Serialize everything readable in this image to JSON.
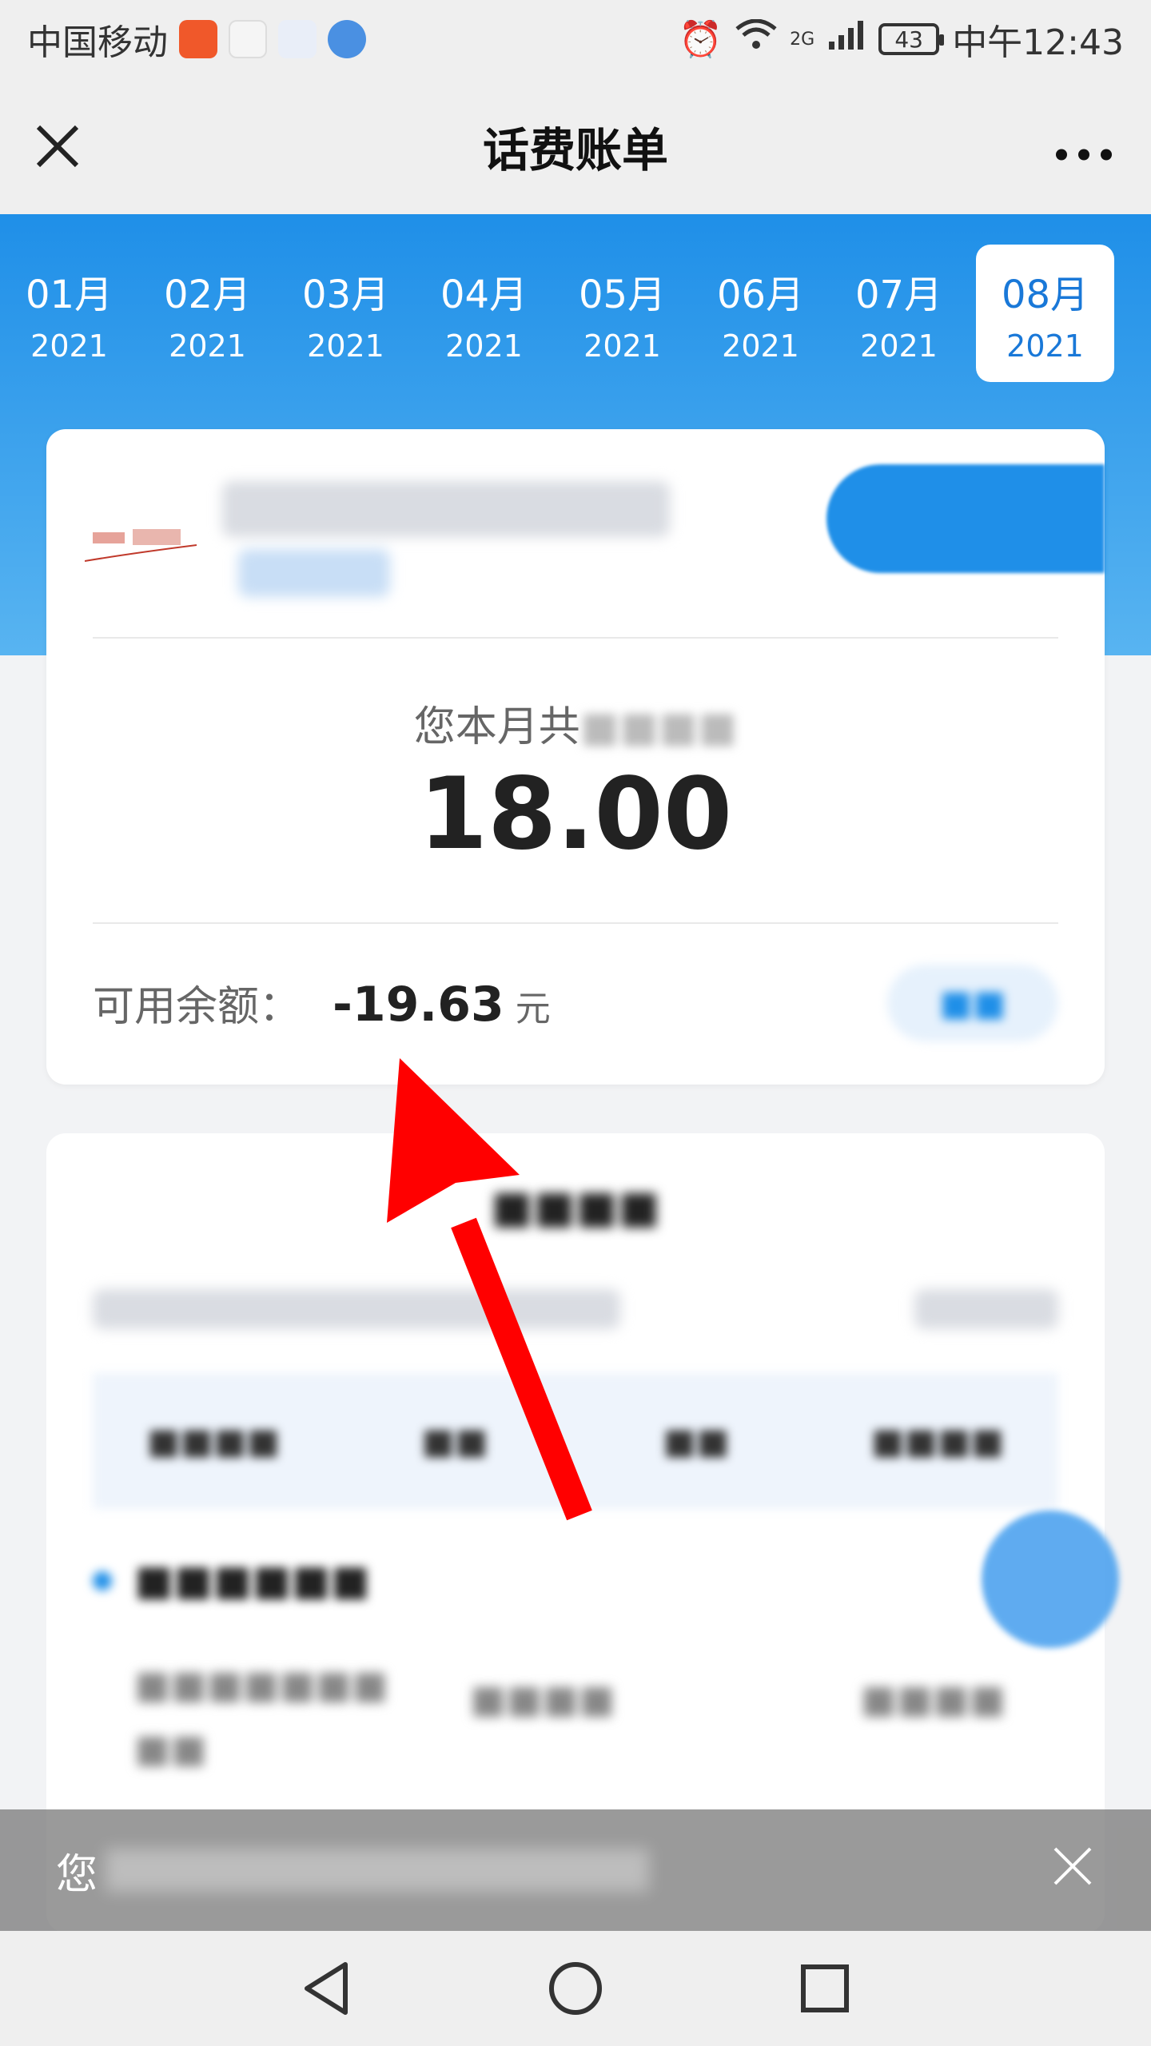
{
  "status_bar": {
    "carrier": "中国移动",
    "network": "2G",
    "battery": "43",
    "time": "中午12:43"
  },
  "header": {
    "title": "话费账单",
    "close_icon": "close-icon",
    "more_icon": "more-icon"
  },
  "months": [
    {
      "month": "01月",
      "year": "2021"
    },
    {
      "month": "02月",
      "year": "2021"
    },
    {
      "month": "03月",
      "year": "2021"
    },
    {
      "month": "04月",
      "year": "2021"
    },
    {
      "month": "05月",
      "year": "2021"
    },
    {
      "month": "06月",
      "year": "2021"
    },
    {
      "month": "07月",
      "year": "2021"
    },
    {
      "month": "08月",
      "year": "2021",
      "active": true
    }
  ],
  "summary": {
    "consume_label": "您本月共",
    "amount": "18.00",
    "balance_label": "可用余额：",
    "balance_value": "-19.63",
    "balance_unit": "元"
  },
  "toast": {
    "text": "您"
  },
  "colors": {
    "brand_blue": "#1f8fe8",
    "arrow_red": "#ff0000"
  }
}
